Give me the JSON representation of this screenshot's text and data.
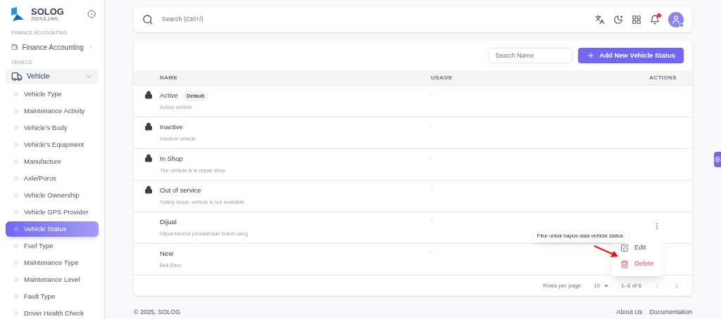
{
  "brand": {
    "name": "SOLOG",
    "version": "2024.6.14#1"
  },
  "sidebar": {
    "sections": [
      {
        "heading": "FINANCE ACCOUNTING",
        "items": [
          {
            "label": "Finance Accounting",
            "kind": "finance",
            "expanded": false,
            "selected": false
          }
        ]
      },
      {
        "heading": "VEHICLE",
        "items": [
          {
            "label": "Vehicle",
            "kind": "vehicle",
            "expanded": true,
            "selected": false,
            "children": [
              {
                "label": "Vehicle Type",
                "selected": false
              },
              {
                "label": "Maintenance Activity",
                "selected": false
              },
              {
                "label": "Vehicle's Body",
                "selected": false
              },
              {
                "label": "Vehicle's Equipment",
                "selected": false
              },
              {
                "label": "Manufacture",
                "selected": false
              },
              {
                "label": "Axle/Poros",
                "selected": false
              },
              {
                "label": "Vehicle Ownership",
                "selected": false
              },
              {
                "label": "Vehicle GPS Provider",
                "selected": false
              },
              {
                "label": "Vehicle Status",
                "selected": true
              },
              {
                "label": "Fuel Type",
                "selected": false
              },
              {
                "label": "Maintenance Type",
                "selected": false
              },
              {
                "label": "Maintenance Level",
                "selected": false
              },
              {
                "label": "Fault Type",
                "selected": false
              },
              {
                "label": "Driver Health Check",
                "selected": false
              }
            ]
          }
        ]
      }
    ]
  },
  "topbar": {
    "search_placeholder": "Search (Ctrl+/)",
    "notification_unread": true,
    "user_online": true
  },
  "table": {
    "search_placeholder": "Search Name",
    "add_button": "Add New Vehicle Status",
    "columns": [
      "NAME",
      "USAGE",
      "ACTIONS"
    ],
    "rows": [
      {
        "name": "Active",
        "badge": "Default",
        "description": "Active vehicle",
        "usage": "-",
        "locked": true,
        "menu_open": false
      },
      {
        "name": "Inactive",
        "description": "Inactive vehicle",
        "usage": "-",
        "locked": true,
        "menu_open": false
      },
      {
        "name": "In Shop",
        "description": "The vehicle is in repair shop",
        "usage": "-",
        "locked": true,
        "menu_open": false
      },
      {
        "name": "Out of service",
        "description": "Safety issue, vehicle is not available",
        "usage": "-",
        "locked": true,
        "menu_open": false
      },
      {
        "name": "Dijual",
        "description": "Dijual karena perusahaan butuh uang",
        "usage": "-",
        "locked": false,
        "menu_open": true
      },
      {
        "name": "New",
        "description": "Beli Baru",
        "usage": "-",
        "locked": false,
        "menu_open": false
      }
    ],
    "menu": [
      {
        "label": "Edit",
        "kind": "edit"
      },
      {
        "label": "Delete",
        "kind": "delete"
      }
    ],
    "callout": "Fitur untuk hapus data vehicle status",
    "pagination": {
      "rows_per_page_label": "Rows per page:",
      "rows_per_page": "10",
      "range": "1–6 of 6"
    }
  },
  "footer": {
    "copyright": "© 2025, SOLOG",
    "links": [
      "About Us",
      "Documentation"
    ]
  }
}
